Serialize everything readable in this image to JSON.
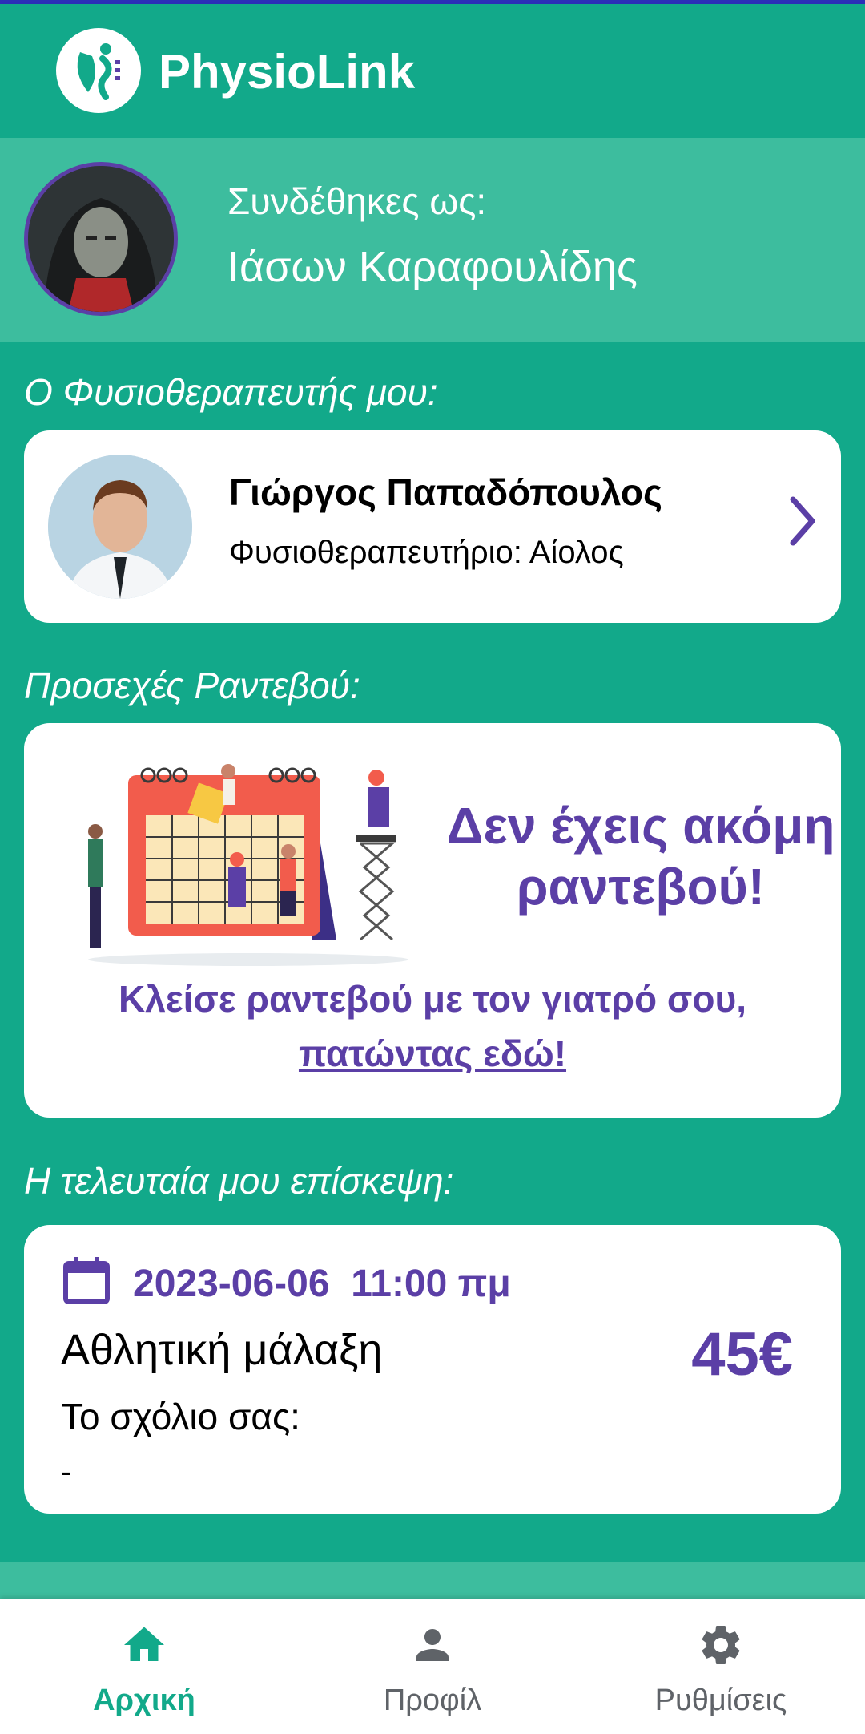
{
  "app": {
    "title": "PhysioLink"
  },
  "user": {
    "logged_in_label": "Συνδέθηκες ως:",
    "name": "Ιάσων Καραφουλίδης"
  },
  "therapist_section": {
    "label": "Ο Φυσιοθεραπευτής μου:",
    "name": "Γιώργος Παπαδόπουλος",
    "clinic": "Φυσιοθεραπευτήριο: Αίολος"
  },
  "appointments_section": {
    "label": "Προσεχές Ραντεβού:",
    "empty_title_line1": "Δεν έχεις ακόμη",
    "empty_title_line2": "ραντεβού!",
    "book_text": "Κλείσε ραντεβού με τον γιατρό σου,",
    "book_link": "πατώντας εδώ!"
  },
  "last_visit_section": {
    "label": "Η τελευταία μου επίσκεψη:",
    "date": "2023-06-06  11:00 πμ",
    "service": "Αθλητική μάλαξη",
    "price": "45€",
    "comment_label": "Το σχόλιο σας:",
    "comment_value": "-"
  },
  "bottom_nav": {
    "items": [
      {
        "label": "Αρχική",
        "icon": "home-icon",
        "active": true
      },
      {
        "label": "Προφίλ",
        "icon": "person-icon",
        "active": false
      },
      {
        "label": "Ρυθμίσεις",
        "icon": "gear-icon",
        "active": false
      }
    ]
  },
  "colors": {
    "primary": "#12a98a",
    "primary_light": "#3dbd9e",
    "accent": "#5b3fa6",
    "nav_inactive": "#5f6368"
  }
}
